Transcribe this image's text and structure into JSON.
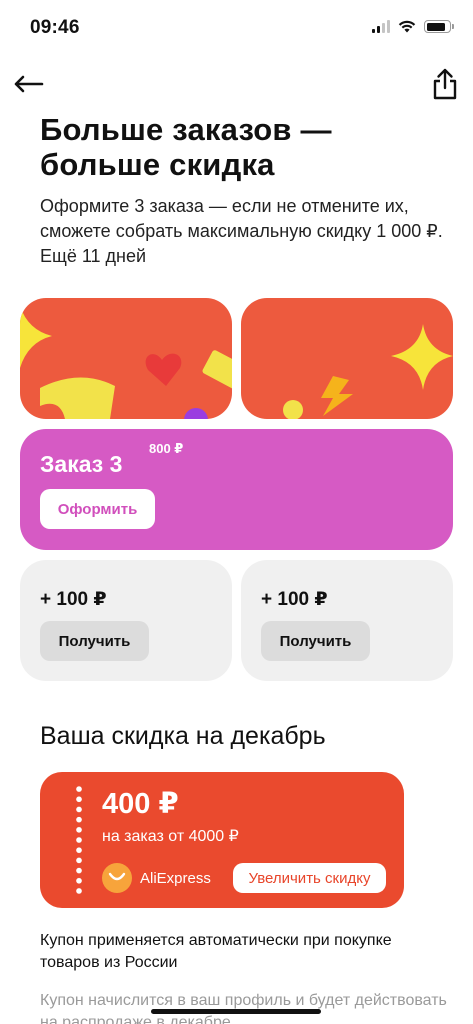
{
  "status_bar": {
    "time": "09:46",
    "icons": [
      "signal-icon",
      "wifi-icon",
      "battery-icon"
    ],
    "battery_level": 0.85
  },
  "nav": {
    "back_icon": "arrow-left-icon",
    "share_icon": "share-icon"
  },
  "header": {
    "title": "Больше заказов — больше скидка",
    "subtitle": "Оформите 3 заказа — если не отмените их, сможете собрать максимальную скидку 1 000 ₽. Ещё 11 дней"
  },
  "banners": [
    {
      "name": "promo-banner-left",
      "color": "#ed5a3e"
    },
    {
      "name": "promo-banner-right",
      "color": "#ed5a3e"
    }
  ],
  "order_card": {
    "title": "Заказ 3",
    "amount": "800 ₽",
    "button_label": "Оформить",
    "color": "#d65ac4"
  },
  "rewards": [
    {
      "amount": "+ 100 ₽",
      "button_label": "Получить"
    },
    {
      "amount": "+ 100 ₽",
      "button_label": "Получить"
    }
  ],
  "discount_section": {
    "title": "Ваша скидка на декабрь",
    "coupon": {
      "value": "400 ₽",
      "condition": "на заказ от 4000 ₽",
      "brand": "AliExpress",
      "button_label": "Увеличить скидку",
      "color": "#ea4a2e"
    }
  },
  "notes": {
    "auto_apply": "Купон применяется автоматически при покупке товаров из России",
    "profile_info": "Купон начислится в ваш профиль и будет действовать на распродаже в декабре"
  },
  "colors": {
    "accent_red": "#ea4a2e",
    "accent_pink": "#d65ac4",
    "card_gray": "#f0f0f0",
    "yellow_shape": "#f7e43a"
  }
}
